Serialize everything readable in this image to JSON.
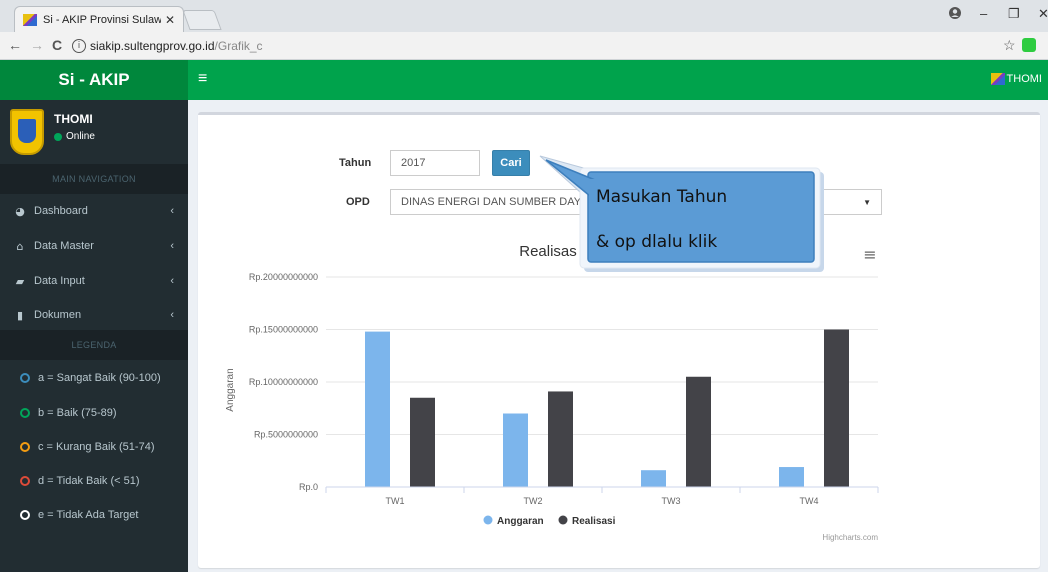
{
  "browser": {
    "tab_title": "Si - AKIP Provinsi Sulawe:",
    "tab_close": "✕",
    "url_host": "siakip.sultengprov.go.id",
    "url_path": "/Grafik_c",
    "back": "←",
    "forward": "→",
    "reload": "C",
    "info": "i",
    "star": "☆",
    "account_icon": "account-circle-icon",
    "minimize": "–",
    "restore": "❐",
    "close": "✕"
  },
  "app": {
    "logo": "Si - AKIP",
    "menu_toggle": "≡",
    "user_nav_name": "THOMI",
    "brand_color": "#00a34c"
  },
  "sidebar": {
    "user_name": "THOMI",
    "status": "Online",
    "main_header": "MAIN NAVIGATION",
    "items": [
      {
        "label": "Dashboard",
        "icon": "tachometer-icon",
        "glyph": "◕"
      },
      {
        "label": "Data Master",
        "icon": "bank-icon",
        "glyph": "⌂"
      },
      {
        "label": "Data Input",
        "icon": "edit-icon",
        "glyph": "▰"
      },
      {
        "label": "Dokumen",
        "icon": "file-icon",
        "glyph": "▮"
      }
    ],
    "caret": "‹",
    "legend_header": "LEGENDA",
    "legend": [
      {
        "label": "a = Sangat Baik (90-100)",
        "color": "#3c8dbc"
      },
      {
        "label": "b = Baik (75-89)",
        "color": "#00a65a"
      },
      {
        "label": "c = Kurang Baik (51-74)",
        "color": "#f39c12"
      },
      {
        "label": "d = Tidak Baik (< 51)",
        "color": "#dd4b39"
      },
      {
        "label": "e = Tidak Ada Target",
        "color": "#ffffff"
      }
    ]
  },
  "form": {
    "tahun_label": "Tahun",
    "tahun_value": "2017",
    "cari_label": "Cari",
    "opd_label": "OPD",
    "opd_value": "DINAS ENERGI DAN SUMBER DAYA",
    "opd_arrow": "▼"
  },
  "callout": {
    "line1": "Masukan Tahun",
    "line2": "& op dlalu klik"
  },
  "chart_data": {
    "type": "bar",
    "title": "Realisas",
    "menu_glyph": "≡",
    "categories": [
      "TW1",
      "TW2",
      "TW3",
      "TW4"
    ],
    "series": [
      {
        "name": "Anggaran",
        "color": "#7cb5ec",
        "values": [
          14800000000,
          7000000000,
          1600000000,
          1900000000
        ]
      },
      {
        "name": "Realisasi",
        "color": "#434348",
        "values": [
          8500000000,
          9100000000,
          10500000000,
          15000000000
        ]
      }
    ],
    "ylabel": "Anggaran",
    "ylim": [
      0,
      20000000000
    ],
    "yticks": [
      0,
      5000000000,
      10000000000,
      15000000000,
      20000000000
    ],
    "ytick_labels": [
      "Rp.0",
      "Rp.5000000000",
      "Rp.10000000000",
      "Rp.15000000000",
      "Rp.20000000000"
    ],
    "grid": true,
    "legend_position": "bottom-center",
    "credits": "Highcharts.com"
  }
}
